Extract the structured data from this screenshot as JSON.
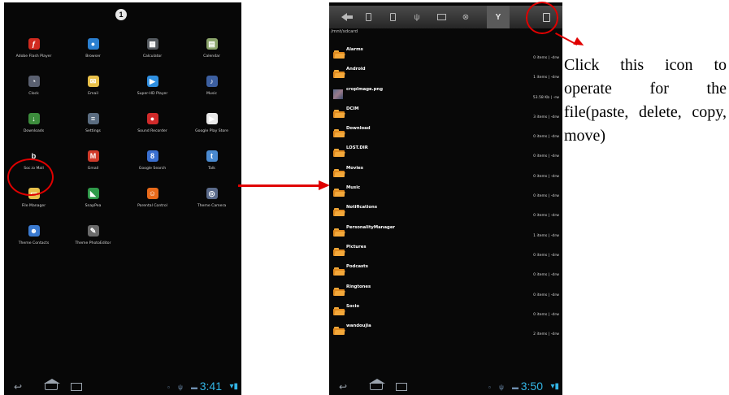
{
  "left_screen": {
    "page_indicator": "1",
    "apps": [
      {
        "label": "Adobe Flash Player",
        "icon": "flash-icon",
        "color": "#d12a1f",
        "glyph": "ƒ"
      },
      {
        "label": "Browser",
        "icon": "globe-icon",
        "color": "#2a7fd0",
        "glyph": "●"
      },
      {
        "label": "Calculator",
        "icon": "calculator-icon",
        "color": "#555a60",
        "glyph": "▦"
      },
      {
        "label": "Calendar",
        "icon": "calendar-icon",
        "color": "#8aa36a",
        "glyph": "▤"
      },
      {
        "label": "Clock",
        "icon": "clock-icon",
        "color": "#5a6070",
        "glyph": "◔"
      },
      {
        "label": "Email",
        "icon": "email-icon",
        "color": "#e8c04a",
        "glyph": "✉"
      },
      {
        "label": "Super-HD Player",
        "icon": "video-player-icon",
        "color": "#2f8fe0",
        "glyph": "▶"
      },
      {
        "label": "Music",
        "icon": "music-icon",
        "color": "#3c5fa0",
        "glyph": "♪"
      },
      {
        "label": "Downloads",
        "icon": "download-icon",
        "color": "#3c8c3c",
        "glyph": "↓"
      },
      {
        "label": "Settings",
        "icon": "settings-icon",
        "color": "#5a6c80",
        "glyph": "≡"
      },
      {
        "label": "Sound Recorder",
        "icon": "microphone-icon",
        "color": "#d02a2a",
        "glyph": "●"
      },
      {
        "label": "Google Play Store",
        "icon": "play-store-icon",
        "color": "#e8e8e8",
        "glyph": "▶"
      },
      {
        "label": "Soc.io Mall",
        "icon": "socio-mall-icon",
        "color": "#070707",
        "glyph": "b"
      },
      {
        "label": "Gmail",
        "icon": "gmail-icon",
        "color": "#d03a2a",
        "glyph": "M"
      },
      {
        "label": "Google Search",
        "icon": "google-search-icon",
        "color": "#3a6fd0",
        "glyph": "8"
      },
      {
        "label": "Talk",
        "icon": "talk-icon",
        "color": "#4a8ad0",
        "glyph": "t"
      },
      {
        "label": "File Manager",
        "icon": "folder-icon",
        "color": "#e8c04a",
        "glyph": "▭"
      },
      {
        "label": "SnapPea",
        "icon": "snappea-icon",
        "color": "#2f9a4a",
        "glyph": "◣"
      },
      {
        "label": "Parental Control",
        "icon": "parental-control-icon",
        "color": "#e86a1a",
        "glyph": "☺"
      },
      {
        "label": "Theme Camera",
        "icon": "camera-icon",
        "color": "#5a6a8a",
        "glyph": "◎"
      },
      {
        "label": "Theme Contacts",
        "icon": "contacts-icon",
        "color": "#3a7ad0",
        "glyph": "☻"
      },
      {
        "label": "Theme PhotoEditor",
        "icon": "photo-editor-icon",
        "color": "#6a6a6a",
        "glyph": "✎"
      }
    ],
    "status_time": "3:41"
  },
  "right_screen": {
    "path": "/mnt/sdcard",
    "status_time": "3:50",
    "files": [
      {
        "name": "Alarms",
        "meta": "0 items | -drw",
        "type": "folder"
      },
      {
        "name": "Android",
        "meta": "1 items | -drw",
        "type": "folder"
      },
      {
        "name": "cropImage.png",
        "meta": "53.58 Kb | -rw",
        "type": "image"
      },
      {
        "name": "DCIM",
        "meta": "3 items | -drw",
        "type": "folder"
      },
      {
        "name": "Download",
        "meta": "0 items | -drw",
        "type": "folder"
      },
      {
        "name": "LOST.DIR",
        "meta": "0 items | -drw",
        "type": "folder"
      },
      {
        "name": "Movies",
        "meta": "0 items | -drw",
        "type": "folder"
      },
      {
        "name": "Music",
        "meta": "0 items | -drw",
        "type": "folder"
      },
      {
        "name": "Notifications",
        "meta": "0 items | -drw",
        "type": "folder"
      },
      {
        "name": "PersonalityManager",
        "meta": "1 items | -drw",
        "type": "folder"
      },
      {
        "name": "Pictures",
        "meta": "0 items | -drw",
        "type": "folder"
      },
      {
        "name": "Podcasts",
        "meta": "0 items | -drw",
        "type": "folder"
      },
      {
        "name": "Ringtones",
        "meta": "0 items | -drw",
        "type": "folder"
      },
      {
        "name": "Socio",
        "meta": "0 items | -drw",
        "type": "folder"
      },
      {
        "name": "wandoujia",
        "meta": "2 items | -drw",
        "type": "folder"
      }
    ]
  },
  "callout": {
    "text": "Click this icon to operate for the file(paste, delete, copy, move)"
  },
  "colors": {
    "annotation_red": "#e00000",
    "clock_blue": "#33b5e5",
    "folder_orange": "#e08a20"
  }
}
